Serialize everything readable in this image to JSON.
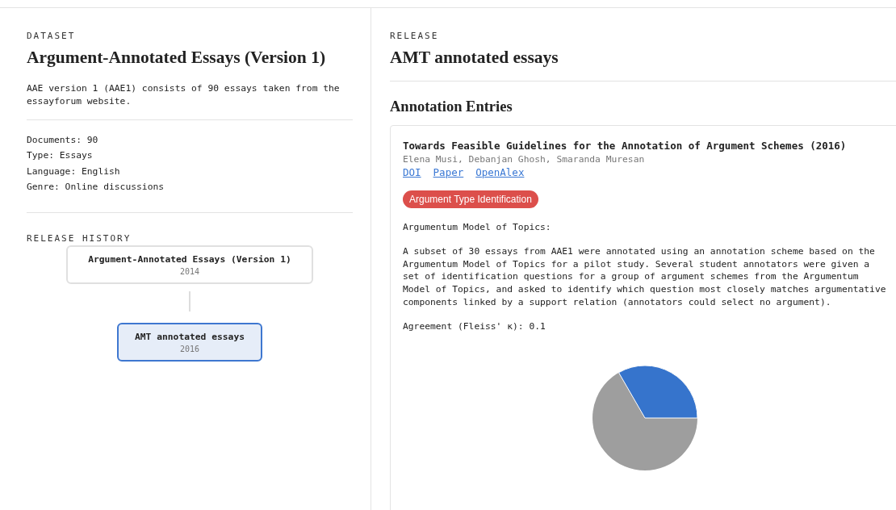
{
  "dataset": {
    "label": "DATASET",
    "title": "Argument-Annotated Essays (Version 1)",
    "description": "AAE version 1 (AAE1) consists of 90 essays taken from the essayforum website.",
    "facts": [
      "Documents: 90",
      "Type: Essays",
      "Language: English",
      "Genre: Online discussions"
    ]
  },
  "release_history": {
    "label": "RELEASE HISTORY",
    "items": [
      {
        "title": "Argument-Annotated Essays (Version 1)",
        "year": "2014",
        "selected": false
      },
      {
        "title": "AMT annotated essays",
        "year": "2016",
        "selected": true
      }
    ]
  },
  "release": {
    "label": "RELEASE",
    "title": "AMT annotated essays",
    "section_title": "Annotation Entries",
    "entries": [
      {
        "title": "Towards Feasible Guidelines for the Annotation of Argument Schemes (2016)",
        "authors": "Elena Musi, Debanjan Ghosh, Smaranda Muresan",
        "links": [
          "DOI",
          "Paper",
          "OpenAlex"
        ],
        "tag": {
          "label": "Argument Type Identification",
          "color": "#dc4f4b"
        },
        "scheme": "Argumentum Model of Topics:",
        "description": "A subset of 30 essays from AAE1 were annotated using an annotation scheme based on the Argumentum Model of Topics for a pilot study. Several student annotators were given a set of identification questions for a group of argument schemes from the Argumentum Model of Topics, and asked to identify which question most closely matches argumentative components linked by a support relation (annotators could select no argument).",
        "agreement": "Agreement (Fleiss' κ): 0.1"
      }
    ]
  }
}
